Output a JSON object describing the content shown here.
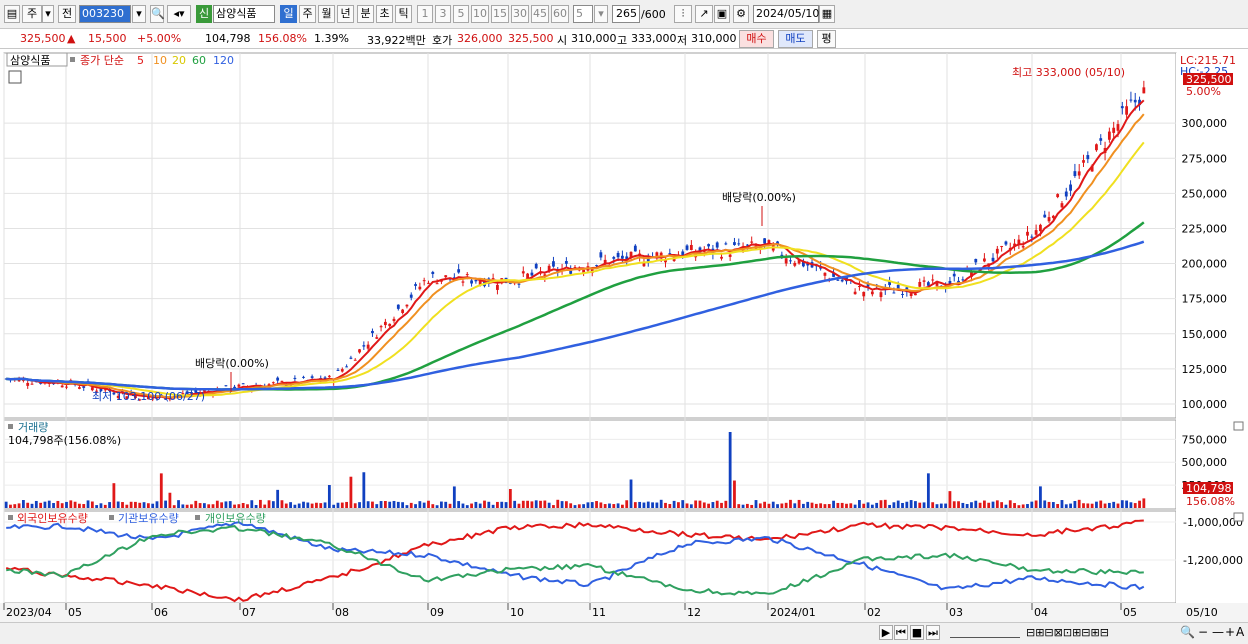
{
  "toolbar": {
    "market": "주",
    "prev_label": "전",
    "code": "003230",
    "credit_badge": "신",
    "stock_name": "삼양식품",
    "periods": [
      "일",
      "주",
      "월",
      "년",
      "분",
      "초",
      "틱"
    ],
    "minute_steps": [
      "1",
      "3",
      "5",
      "10",
      "15",
      "30",
      "45",
      "60"
    ],
    "interval_value": "5",
    "count": "265",
    "count_max": "/600",
    "date": "2024/05/10"
  },
  "quote": {
    "price": "325,500",
    "change": "15,500",
    "change_pct": "+5.00%",
    "volume": "104,798",
    "volume_ratio": "156.08%",
    "turnover": "1.39%",
    "amount": "33,922백만",
    "bid_ask_label": "호가",
    "ask": "326,000",
    "bid": "325,500",
    "open_label": "시",
    "open": "310,000",
    "high_label": "고",
    "high": "333,000",
    "low_label": "저",
    "low": "310,000",
    "buy_label": "매수",
    "sell_label": "매도",
    "eval_label": "평"
  },
  "price_panel": {
    "name": "삼양식품",
    "ma_label": "종가 단순",
    "ma_periods": [
      "5",
      "10",
      "20",
      "60",
      "120"
    ],
    "ma_colors": [
      "#e01818",
      "#f09020",
      "#f0e020",
      "#20a040",
      "#3060e0"
    ],
    "max_annotation": "최고 333,000 (05/10)",
    "min_annotation": "최저 103,100 (06/27)",
    "dividend_1": "배당락(0.00%)",
    "dividend_2": "배당락(0.00%)",
    "lc": "LC:215.71",
    "hc": "HC:-2.25",
    "last_tag": "325,500",
    "pct_tag": "5.00%"
  },
  "volume_panel": {
    "title": "거래량",
    "value": "104,798주(156.08%)",
    "tag1": "104,798",
    "tag2": "156.08%"
  },
  "holding_panel": {
    "series": [
      "외국인보유수량",
      "기관보유수량",
      "개인보유수량"
    ],
    "colors": [
      "#e01818",
      "#3060e0",
      "#30a060"
    ]
  },
  "x_labels": [
    "2023/04",
    "05",
    "06",
    "07",
    "08",
    "09",
    "10",
    "11",
    "12",
    "2024/01",
    "02",
    "03",
    "04",
    "05"
  ],
  "x_last": "05/10",
  "chart_data": [
    {
      "type": "candlestick",
      "name": "삼양식품",
      "ylim": [
        90000,
        340000
      ],
      "y_ticks": [
        "100,000",
        "125,000",
        "150,000",
        "175,000",
        "200,000",
        "225,000",
        "250,000",
        "275,000",
        "300,000"
      ],
      "y_tick_values": [
        100000,
        125000,
        150000,
        175000,
        200000,
        225000,
        250000,
        275000,
        300000
      ],
      "x": [
        "2023/04",
        "05",
        "06",
        "07",
        "08",
        "09",
        "10",
        "11",
        "12",
        "2024/01",
        "02",
        "03",
        "04",
        "05/10"
      ],
      "close": [
        118000,
        115000,
        104000,
        112000,
        118000,
        190000,
        188000,
        200000,
        208000,
        212000,
        180000,
        185000,
        220000,
        325500
      ],
      "ma120": [
        118000,
        117000,
        116000,
        115000,
        118000,
        135000,
        150000,
        165000,
        180000,
        195000,
        198000,
        200000,
        205000,
        214000
      ],
      "ma60": [
        120000,
        118000,
        114000,
        113000,
        120000,
        160000,
        185000,
        195000,
        205000,
        208000,
        200000,
        196000,
        195000,
        223000
      ]
    },
    {
      "type": "bar",
      "name": "거래량",
      "y_ticks": [
        "250,000",
        "500,000",
        "750,000"
      ],
      "y_tick_values": [
        250000,
        500000,
        750000
      ],
      "peak": 830000,
      "last": 104798
    },
    {
      "type": "line",
      "name": "보유수량",
      "series": [
        "외국인보유수량",
        "기관보유수량",
        "개인보유수량"
      ],
      "y_ticks": [
        "-1,000,000",
        "-1,200,000"
      ],
      "y_tick_values": [
        -1000000,
        -1200000
      ]
    }
  ]
}
